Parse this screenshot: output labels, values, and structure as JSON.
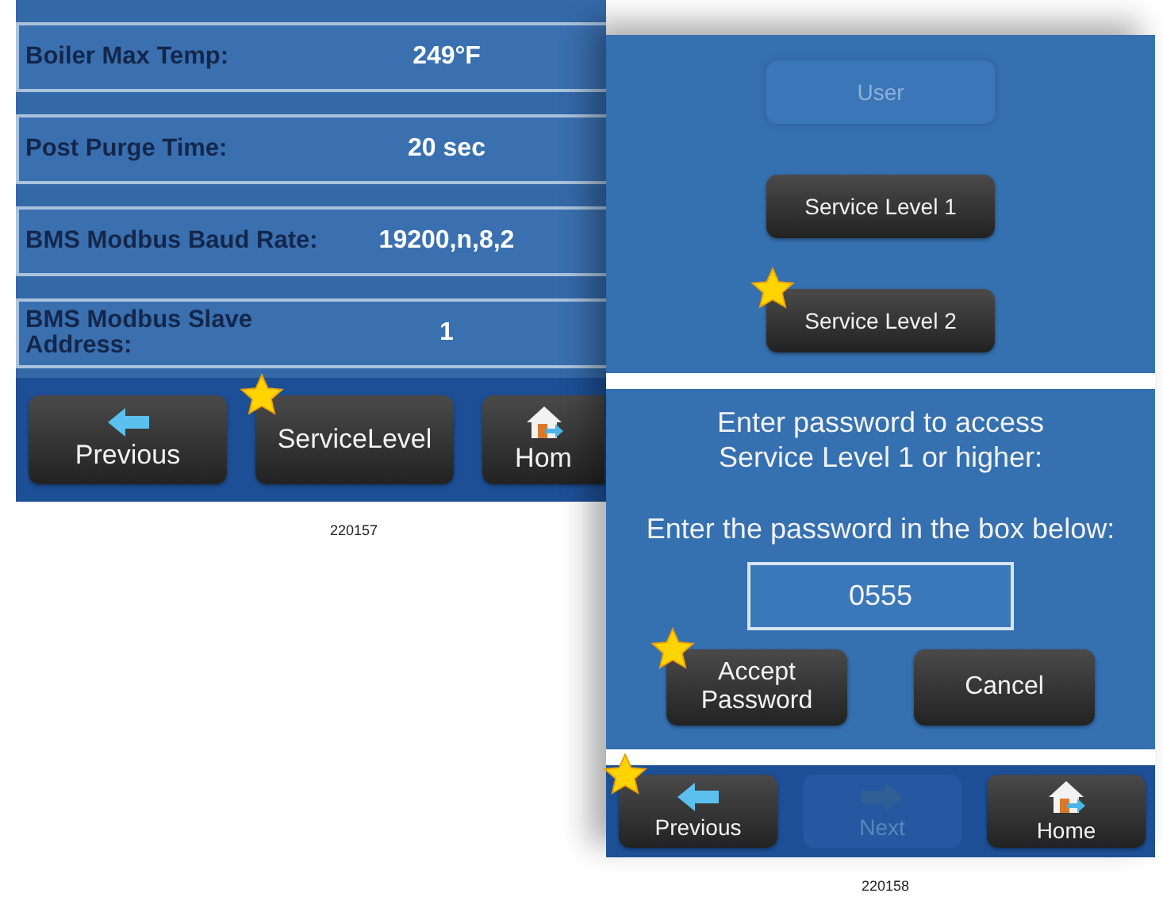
{
  "left_screen": {
    "settings": [
      {
        "label": "Boiler Max Temp:",
        "value": "249°F"
      },
      {
        "label": "Post Purge Time:",
        "value": "20 sec"
      },
      {
        "label": "BMS Modbus Baud Rate:",
        "value": "19200,n,8,2"
      },
      {
        "label": "BMS Modbus Slave Address:",
        "value": "1"
      }
    ],
    "footer": [
      {
        "label": "Previous",
        "kind": "back",
        "disabled": false,
        "starred": false
      },
      {
        "label": "ServiceLevel",
        "kind": "service",
        "disabled": false,
        "starred": true
      },
      {
        "label": "Hom",
        "kind": "home",
        "disabled": false,
        "starred": false
      }
    ],
    "caption": "220157"
  },
  "right_panel": {
    "levels": [
      {
        "label": "User",
        "disabled": true,
        "starred": false
      },
      {
        "label": "Service Level 1",
        "disabled": false,
        "starred": false
      },
      {
        "label": "Service Level 2",
        "disabled": false,
        "starred": true
      }
    ],
    "password_prompt": {
      "heading": "Enter password to access Service Level 1 or higher:",
      "instruction": "Enter the password in the box below:",
      "value": "0555"
    },
    "actions": [
      {
        "label": "Accept Password",
        "starred": true
      },
      {
        "label": "Cancel",
        "starred": false
      }
    ],
    "footer": [
      {
        "label": "Previous",
        "kind": "back",
        "disabled": false,
        "starred": true
      },
      {
        "label": "Next",
        "kind": "next",
        "disabled": true,
        "starred": false
      },
      {
        "label": "Home",
        "kind": "home",
        "disabled": false,
        "starred": false
      }
    ],
    "caption": "220158"
  }
}
